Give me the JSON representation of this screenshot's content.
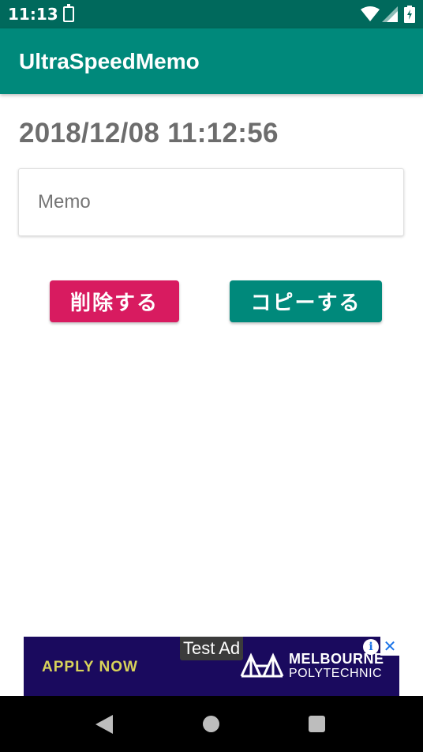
{
  "status_bar": {
    "time": "11:13",
    "icons": [
      "battery-saver-icon",
      "wifi-icon",
      "signal-icon",
      "battery-icon"
    ]
  },
  "app_bar": {
    "title": "UltraSpeedMemo"
  },
  "main": {
    "timestamp": "2018/12/08 11:12:56",
    "memo_field": {
      "value": "",
      "placeholder": "Memo"
    },
    "delete_button_label": "削除する",
    "copy_button_label": "コピーする"
  },
  "ad_banner": {
    "test_label": "Test Ad",
    "cta": "APPLY NOW",
    "brand_line1": "MELBOURNE",
    "brand_line2": "POLYTECHNIC",
    "info_glyph": "i",
    "close_glyph": "✕"
  },
  "nav_bar": {
    "buttons": [
      "back-icon",
      "home-icon",
      "recents-icon"
    ]
  },
  "colors": {
    "status_bar": "#00695c",
    "app_bar": "#00897b",
    "delete_button": "#d81b60",
    "copy_button": "#00897b",
    "ad_background": "#1a0a5e",
    "ad_cta": "#d8d35a"
  }
}
